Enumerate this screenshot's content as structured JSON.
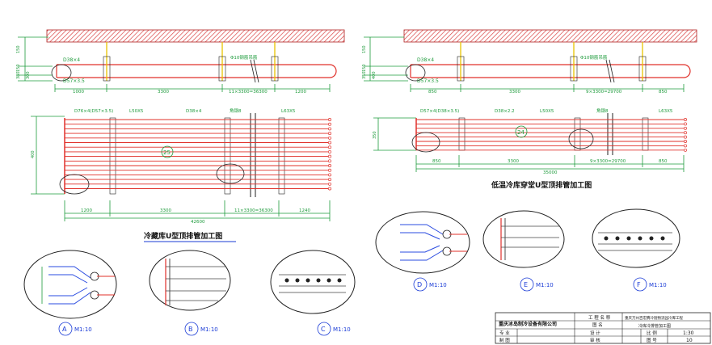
{
  "left_drawing": {
    "caption": "冷藏库U型顶排管加工图",
    "section_labels": {
      "pipe": "D38×4",
      "bracket": "D57×3.5",
      "rod": "Φ10钢筋吊筋"
    },
    "elevation_dims": [
      "1000",
      "3300",
      "11×3300=36300",
      "1200"
    ],
    "side_dims": [
      "150",
      "150",
      "380",
      "300"
    ],
    "plan_labels": [
      "D76×4(D57×3.5)",
      "L50X5",
      "D38×4",
      "角钢8",
      "L63X5"
    ],
    "plan_dims": [
      "1200",
      "3300",
      "11×3300=36300",
      "1240"
    ],
    "plan_total": "42600",
    "plan_side_dim": "400",
    "circle_label": "25",
    "details": [
      {
        "label": "A",
        "scale": "M1:10"
      },
      {
        "label": "B",
        "scale": "M1:10"
      },
      {
        "label": "C",
        "scale": "M1:10"
      }
    ]
  },
  "right_drawing": {
    "caption": "低温冷库穿堂U型顶排管加工图",
    "section_labels": {
      "pipe": "D38×4",
      "bracket": "D57×3.5",
      "rod": "Φ10钢筋吊筋"
    },
    "elevation_dims": [
      "850",
      "3300",
      "9×3300=29700",
      "850"
    ],
    "side_dims": [
      "150",
      "150",
      "350",
      "400"
    ],
    "plan_labels": [
      "D57×4(D38×3.5)",
      "D38×2.2",
      "L50X5",
      "角钢8",
      "L63X5"
    ],
    "plan_dims": [
      "850",
      "3300",
      "9×3300=29700",
      "850"
    ],
    "plan_total": "35000",
    "plan_side_dim": "350",
    "circle_label": "24",
    "details": [
      {
        "label": "D",
        "scale": "M1:10"
      },
      {
        "label": "E",
        "scale": "M1:10"
      },
      {
        "label": "F",
        "scale": "M1:10"
      }
    ]
  },
  "title_block": {
    "company": "重庆冰岛制冷设备有限公司",
    "project_label": "工 程 名 称",
    "project_name": "重庆万州百宏腾冷链物流园冷库工程",
    "drawing_label": "图 名",
    "drawing_name": "冷库冷排管加工图",
    "design_label": "设 计",
    "scale_label": "比 例",
    "scale_value": "1:30",
    "review_label": "审 核",
    "sheet_label": "图 号",
    "sheet_value": "10",
    "discipline_label": "专 业",
    "drawn_label": "制 图"
  },
  "colors": {
    "pipe": "#e0302a",
    "dimension": "#1e9b3c",
    "hatch": "#d94040",
    "label_blue": "#1a3bd6",
    "hanger": "#e8c400"
  }
}
